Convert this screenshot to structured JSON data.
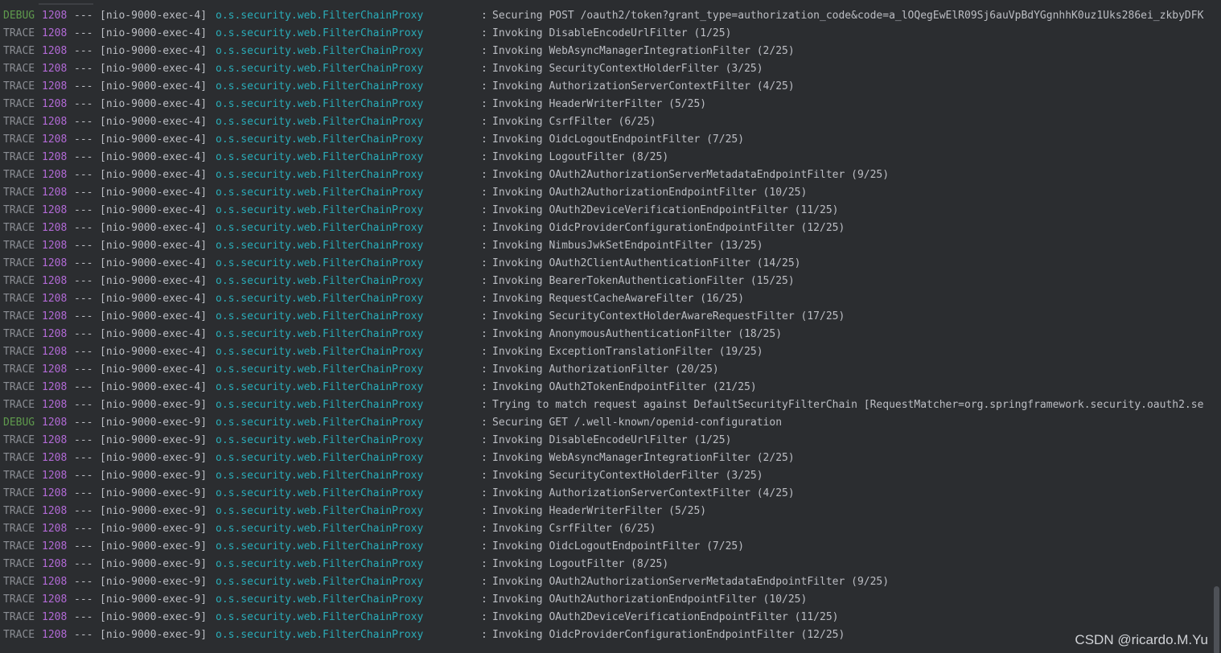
{
  "console": {
    "lines": [
      {
        "level": "DEBUG",
        "pid": "1208",
        "sep": "---",
        "thread": "[nio-9000-exec-4]",
        "logger": "o.s.security.web.FilterChainProxy",
        "colon": ":",
        "message": "Securing POST /oauth2/token?grant_type=authorization_code&code=a_lOQegEwElR09Sj6auVpBdYGgnhhK0uz1Uks286ei_zkbyDFK"
      },
      {
        "level": "TRACE",
        "pid": "1208",
        "sep": "---",
        "thread": "[nio-9000-exec-4]",
        "logger": "o.s.security.web.FilterChainProxy",
        "colon": ":",
        "message": "Invoking DisableEncodeUrlFilter (1/25)"
      },
      {
        "level": "TRACE",
        "pid": "1208",
        "sep": "---",
        "thread": "[nio-9000-exec-4]",
        "logger": "o.s.security.web.FilterChainProxy",
        "colon": ":",
        "message": "Invoking WebAsyncManagerIntegrationFilter (2/25)"
      },
      {
        "level": "TRACE",
        "pid": "1208",
        "sep": "---",
        "thread": "[nio-9000-exec-4]",
        "logger": "o.s.security.web.FilterChainProxy",
        "colon": ":",
        "message": "Invoking SecurityContextHolderFilter (3/25)"
      },
      {
        "level": "TRACE",
        "pid": "1208",
        "sep": "---",
        "thread": "[nio-9000-exec-4]",
        "logger": "o.s.security.web.FilterChainProxy",
        "colon": ":",
        "message": "Invoking AuthorizationServerContextFilter (4/25)"
      },
      {
        "level": "TRACE",
        "pid": "1208",
        "sep": "---",
        "thread": "[nio-9000-exec-4]",
        "logger": "o.s.security.web.FilterChainProxy",
        "colon": ":",
        "message": "Invoking HeaderWriterFilter (5/25)"
      },
      {
        "level": "TRACE",
        "pid": "1208",
        "sep": "---",
        "thread": "[nio-9000-exec-4]",
        "logger": "o.s.security.web.FilterChainProxy",
        "colon": ":",
        "message": "Invoking CsrfFilter (6/25)"
      },
      {
        "level": "TRACE",
        "pid": "1208",
        "sep": "---",
        "thread": "[nio-9000-exec-4]",
        "logger": "o.s.security.web.FilterChainProxy",
        "colon": ":",
        "message": "Invoking OidcLogoutEndpointFilter (7/25)"
      },
      {
        "level": "TRACE",
        "pid": "1208",
        "sep": "---",
        "thread": "[nio-9000-exec-4]",
        "logger": "o.s.security.web.FilterChainProxy",
        "colon": ":",
        "message": "Invoking LogoutFilter (8/25)"
      },
      {
        "level": "TRACE",
        "pid": "1208",
        "sep": "---",
        "thread": "[nio-9000-exec-4]",
        "logger": "o.s.security.web.FilterChainProxy",
        "colon": ":",
        "message": "Invoking OAuth2AuthorizationServerMetadataEndpointFilter (9/25)"
      },
      {
        "level": "TRACE",
        "pid": "1208",
        "sep": "---",
        "thread": "[nio-9000-exec-4]",
        "logger": "o.s.security.web.FilterChainProxy",
        "colon": ":",
        "message": "Invoking OAuth2AuthorizationEndpointFilter (10/25)"
      },
      {
        "level": "TRACE",
        "pid": "1208",
        "sep": "---",
        "thread": "[nio-9000-exec-4]",
        "logger": "o.s.security.web.FilterChainProxy",
        "colon": ":",
        "message": "Invoking OAuth2DeviceVerificationEndpointFilter (11/25)"
      },
      {
        "level": "TRACE",
        "pid": "1208",
        "sep": "---",
        "thread": "[nio-9000-exec-4]",
        "logger": "o.s.security.web.FilterChainProxy",
        "colon": ":",
        "message": "Invoking OidcProviderConfigurationEndpointFilter (12/25)"
      },
      {
        "level": "TRACE",
        "pid": "1208",
        "sep": "---",
        "thread": "[nio-9000-exec-4]",
        "logger": "o.s.security.web.FilterChainProxy",
        "colon": ":",
        "message": "Invoking NimbusJwkSetEndpointFilter (13/25)"
      },
      {
        "level": "TRACE",
        "pid": "1208",
        "sep": "---",
        "thread": "[nio-9000-exec-4]",
        "logger": "o.s.security.web.FilterChainProxy",
        "colon": ":",
        "message": "Invoking OAuth2ClientAuthenticationFilter (14/25)"
      },
      {
        "level": "TRACE",
        "pid": "1208",
        "sep": "---",
        "thread": "[nio-9000-exec-4]",
        "logger": "o.s.security.web.FilterChainProxy",
        "colon": ":",
        "message": "Invoking BearerTokenAuthenticationFilter (15/25)"
      },
      {
        "level": "TRACE",
        "pid": "1208",
        "sep": "---",
        "thread": "[nio-9000-exec-4]",
        "logger": "o.s.security.web.FilterChainProxy",
        "colon": ":",
        "message": "Invoking RequestCacheAwareFilter (16/25)"
      },
      {
        "level": "TRACE",
        "pid": "1208",
        "sep": "---",
        "thread": "[nio-9000-exec-4]",
        "logger": "o.s.security.web.FilterChainProxy",
        "colon": ":",
        "message": "Invoking SecurityContextHolderAwareRequestFilter (17/25)"
      },
      {
        "level": "TRACE",
        "pid": "1208",
        "sep": "---",
        "thread": "[nio-9000-exec-4]",
        "logger": "o.s.security.web.FilterChainProxy",
        "colon": ":",
        "message": "Invoking AnonymousAuthenticationFilter (18/25)"
      },
      {
        "level": "TRACE",
        "pid": "1208",
        "sep": "---",
        "thread": "[nio-9000-exec-4]",
        "logger": "o.s.security.web.FilterChainProxy",
        "colon": ":",
        "message": "Invoking ExceptionTranslationFilter (19/25)"
      },
      {
        "level": "TRACE",
        "pid": "1208",
        "sep": "---",
        "thread": "[nio-9000-exec-4]",
        "logger": "o.s.security.web.FilterChainProxy",
        "colon": ":",
        "message": "Invoking AuthorizationFilter (20/25)"
      },
      {
        "level": "TRACE",
        "pid": "1208",
        "sep": "---",
        "thread": "[nio-9000-exec-4]",
        "logger": "o.s.security.web.FilterChainProxy",
        "colon": ":",
        "message": "Invoking OAuth2TokenEndpointFilter (21/25)"
      },
      {
        "level": "TRACE",
        "pid": "1208",
        "sep": "---",
        "thread": "[nio-9000-exec-9]",
        "logger": "o.s.security.web.FilterChainProxy",
        "colon": ":",
        "message": "Trying to match request against DefaultSecurityFilterChain [RequestMatcher=org.springframework.security.oauth2.se"
      },
      {
        "level": "DEBUG",
        "pid": "1208",
        "sep": "---",
        "thread": "[nio-9000-exec-9]",
        "logger": "o.s.security.web.FilterChainProxy",
        "colon": ":",
        "message": "Securing GET /.well-known/openid-configuration"
      },
      {
        "level": "TRACE",
        "pid": "1208",
        "sep": "---",
        "thread": "[nio-9000-exec-9]",
        "logger": "o.s.security.web.FilterChainProxy",
        "colon": ":",
        "message": "Invoking DisableEncodeUrlFilter (1/25)"
      },
      {
        "level": "TRACE",
        "pid": "1208",
        "sep": "---",
        "thread": "[nio-9000-exec-9]",
        "logger": "o.s.security.web.FilterChainProxy",
        "colon": ":",
        "message": "Invoking WebAsyncManagerIntegrationFilter (2/25)"
      },
      {
        "level": "TRACE",
        "pid": "1208",
        "sep": "---",
        "thread": "[nio-9000-exec-9]",
        "logger": "o.s.security.web.FilterChainProxy",
        "colon": ":",
        "message": "Invoking SecurityContextHolderFilter (3/25)"
      },
      {
        "level": "TRACE",
        "pid": "1208",
        "sep": "---",
        "thread": "[nio-9000-exec-9]",
        "logger": "o.s.security.web.FilterChainProxy",
        "colon": ":",
        "message": "Invoking AuthorizationServerContextFilter (4/25)"
      },
      {
        "level": "TRACE",
        "pid": "1208",
        "sep": "---",
        "thread": "[nio-9000-exec-9]",
        "logger": "o.s.security.web.FilterChainProxy",
        "colon": ":",
        "message": "Invoking HeaderWriterFilter (5/25)"
      },
      {
        "level": "TRACE",
        "pid": "1208",
        "sep": "---",
        "thread": "[nio-9000-exec-9]",
        "logger": "o.s.security.web.FilterChainProxy",
        "colon": ":",
        "message": "Invoking CsrfFilter (6/25)"
      },
      {
        "level": "TRACE",
        "pid": "1208",
        "sep": "---",
        "thread": "[nio-9000-exec-9]",
        "logger": "o.s.security.web.FilterChainProxy",
        "colon": ":",
        "message": "Invoking OidcLogoutEndpointFilter (7/25)"
      },
      {
        "level": "TRACE",
        "pid": "1208",
        "sep": "---",
        "thread": "[nio-9000-exec-9]",
        "logger": "o.s.security.web.FilterChainProxy",
        "colon": ":",
        "message": "Invoking LogoutFilter (8/25)"
      },
      {
        "level": "TRACE",
        "pid": "1208",
        "sep": "---",
        "thread": "[nio-9000-exec-9]",
        "logger": "o.s.security.web.FilterChainProxy",
        "colon": ":",
        "message": "Invoking OAuth2AuthorizationServerMetadataEndpointFilter (9/25)"
      },
      {
        "level": "TRACE",
        "pid": "1208",
        "sep": "---",
        "thread": "[nio-9000-exec-9]",
        "logger": "o.s.security.web.FilterChainProxy",
        "colon": ":",
        "message": "Invoking OAuth2AuthorizationEndpointFilter (10/25)"
      },
      {
        "level": "TRACE",
        "pid": "1208",
        "sep": "---",
        "thread": "[nio-9000-exec-9]",
        "logger": "o.s.security.web.FilterChainProxy",
        "colon": ":",
        "message": "Invoking OAuth2DeviceVerificationEndpointFilter (11/25)"
      },
      {
        "level": "TRACE",
        "pid": "1208",
        "sep": "---",
        "thread": "[nio-9000-exec-9]",
        "logger": "o.s.security.web.FilterChainProxy",
        "colon": ":",
        "message": "Invoking OidcProviderConfigurationEndpointFilter (12/25)"
      }
    ]
  },
  "watermark": "CSDN @ricardo.M.Yu",
  "colors": {
    "background": "#2b2d30",
    "debug": "#5f9a4d",
    "trace": "#8a8d93",
    "pid": "#b26ad6",
    "logger": "#2aacb8",
    "text": "#bcbec4"
  }
}
